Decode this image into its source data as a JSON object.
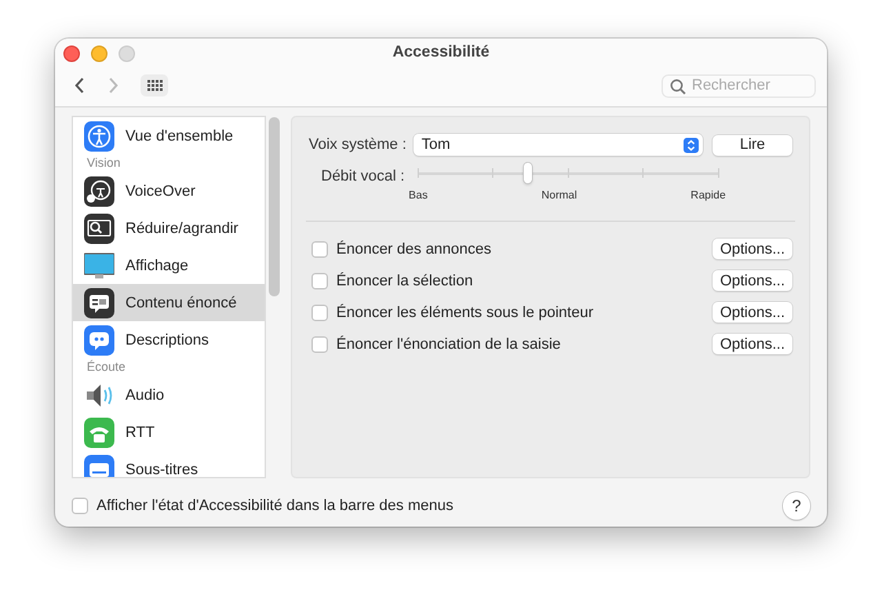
{
  "window": {
    "title": "Accessibilité"
  },
  "toolbar": {
    "search": {
      "placeholder": "Rechercher"
    }
  },
  "sidebar": {
    "items": [
      {
        "kind": "item",
        "label": "Vue d'ensemble",
        "selected": false
      },
      {
        "kind": "header",
        "label": "Vision"
      },
      {
        "kind": "item",
        "label": "VoiceOver",
        "selected": false
      },
      {
        "kind": "item",
        "label": "Réduire/agrandir",
        "selected": false
      },
      {
        "kind": "item",
        "label": "Affichage",
        "selected": false
      },
      {
        "kind": "item",
        "label": "Contenu énoncé",
        "selected": true
      },
      {
        "kind": "item",
        "label": "Descriptions",
        "selected": false
      },
      {
        "kind": "header",
        "label": "Écoute"
      },
      {
        "kind": "item",
        "label": "Audio",
        "selected": false
      },
      {
        "kind": "item",
        "label": "RTT",
        "selected": false
      },
      {
        "kind": "item",
        "label": "Sous-titres",
        "selected": false
      }
    ]
  },
  "panel": {
    "voice": {
      "label": "Voix système :",
      "value": "Tom",
      "button": "Lire"
    },
    "rate": {
      "label": "Débit vocal :",
      "level": 0.37,
      "ticks": [
        "Bas",
        "Normal",
        "Rapide"
      ]
    },
    "options": [
      {
        "label": "Énoncer des annonces",
        "checked": false,
        "button": "Options..."
      },
      {
        "label": "Énoncer la sélection",
        "checked": false,
        "button": "Options..."
      },
      {
        "label": "Énoncer les éléments sous le pointeur",
        "checked": false,
        "button": "Options..."
      },
      {
        "label": "Énoncer l'énonciation de la saisie",
        "checked": false,
        "button": "Options..."
      }
    ]
  },
  "footer": {
    "label": "Afficher l'état d'Accessibilité dans la barre des menus",
    "checked": false,
    "help": "?"
  }
}
